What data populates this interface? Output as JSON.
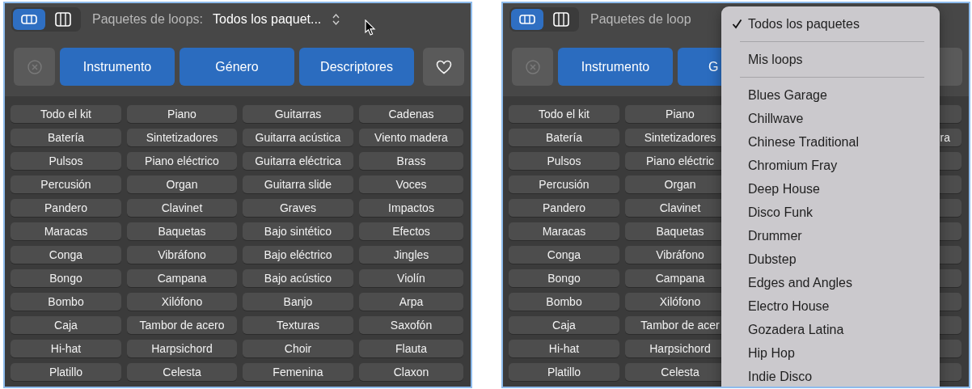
{
  "panels": [
    {
      "view_modes": [
        {
          "kind": "rows",
          "selected": true
        },
        {
          "kind": "columns",
          "selected": false
        }
      ],
      "packs_label": "Paquetes de loops:",
      "packs_value": "Todos los paquet...",
      "filters": [
        {
          "kind": "clear",
          "disabled": true
        },
        {
          "kind": "category",
          "label": "Instrumento"
        },
        {
          "kind": "category",
          "label": "Género"
        },
        {
          "kind": "category",
          "label": "Descriptores"
        },
        {
          "kind": "favorite",
          "show_icon": true
        }
      ],
      "rows": [
        {
          "column_1": "Todo el kit",
          "column_2": "Piano",
          "column_3": "Guitarras",
          "column_4": "Cadenas"
        },
        {
          "column_1": "Batería",
          "column_2": "Sintetizadores",
          "column_3": "Guitarra acústica",
          "column_4": "Viento madera"
        },
        {
          "column_1": "Pulsos",
          "column_2": "Piano eléctrico",
          "column_3": "Guitarra eléctrica",
          "column_4": "Brass"
        },
        {
          "column_1": "Percusión",
          "column_2": "Organ",
          "column_3": "Guitarra slide",
          "column_4": "Voces"
        },
        {
          "column_1": "Pandero",
          "column_2": "Clavinet",
          "column_3": "Graves",
          "column_4": "Impactos"
        },
        {
          "column_1": "Maracas",
          "column_2": "Baquetas",
          "column_3": "Bajo sintético",
          "column_4": "Efectos"
        },
        {
          "column_1": "Conga",
          "column_2": "Vibráfono",
          "column_3": "Bajo eléctrico",
          "column_4": "Jingles"
        },
        {
          "column_1": "Bongo",
          "column_2": "Campana",
          "column_3": "Bajo acústico",
          "column_4": "Violín"
        },
        {
          "column_1": "Bombo",
          "column_2": "Xilófono",
          "column_3": "Banjo",
          "column_4": "Arpa"
        },
        {
          "column_1": "Caja",
          "column_2": "Tambor de acero",
          "column_3": "Texturas",
          "column_4": "Saxofón"
        },
        {
          "column_1": "Hi-hat",
          "column_2": "Harpsichord",
          "column_3": "Choir",
          "column_4": "Flauta"
        },
        {
          "column_1": "Platillo",
          "column_2": "Celesta",
          "column_3": "Femenina",
          "column_4": "Claxon"
        }
      ]
    },
    {
      "view_modes": [
        {
          "kind": "rows",
          "selected": true
        },
        {
          "kind": "columns",
          "selected": false
        }
      ],
      "packs_label": "Paquetes de loop",
      "filters": [
        {
          "kind": "clear",
          "disabled": true
        },
        {
          "kind": "category",
          "label": "Instrumento"
        },
        {
          "kind": "category",
          "label": "G"
        },
        {
          "kind": "favorite",
          "show_icon": false
        }
      ],
      "rows": [
        {
          "column_1": "Todo el kit",
          "column_2": "Piano"
        },
        {
          "column_1": "Batería",
          "column_2": "Sintetizadores",
          "column_4": "ra"
        },
        {
          "column_1": "Pulsos",
          "column_2": "Piano eléctric"
        },
        {
          "column_1": "Percusión",
          "column_2": "Organ"
        },
        {
          "column_1": "Pandero",
          "column_2": "Clavinet"
        },
        {
          "column_1": "Maracas",
          "column_2": "Baquetas"
        },
        {
          "column_1": "Conga",
          "column_2": "Vibráfono"
        },
        {
          "column_1": "Bongo",
          "column_2": "Campana"
        },
        {
          "column_1": "Bombo",
          "column_2": "Xilófono"
        },
        {
          "column_1": "Caja",
          "column_2": "Tambor de acer"
        },
        {
          "column_1": "Hi-hat",
          "column_2": "Harpsichord"
        },
        {
          "column_1": "Platillo",
          "column_2": "Celesta"
        }
      ],
      "menu": [
        {
          "kind": "item",
          "label": "Todos los paquetes",
          "checked": true
        },
        {
          "kind": "separator"
        },
        {
          "kind": "item",
          "label": "Mis loops",
          "checked": false
        },
        {
          "kind": "separator"
        },
        {
          "kind": "item",
          "label": "Blues Garage",
          "checked": false
        },
        {
          "kind": "item",
          "label": "Chillwave",
          "checked": false
        },
        {
          "kind": "item",
          "label": "Chinese Traditional",
          "checked": false
        },
        {
          "kind": "item",
          "label": "Chromium Fray",
          "checked": false
        },
        {
          "kind": "item",
          "label": "Deep House",
          "checked": false
        },
        {
          "kind": "item",
          "label": "Disco Funk",
          "checked": false
        },
        {
          "kind": "item",
          "label": "Drummer",
          "checked": false
        },
        {
          "kind": "item",
          "label": "Dubstep",
          "checked": false
        },
        {
          "kind": "item",
          "label": "Edges and Angles",
          "checked": false
        },
        {
          "kind": "item",
          "label": "Electro House",
          "checked": false
        },
        {
          "kind": "item",
          "label": "Gozadera Latina",
          "checked": false
        },
        {
          "kind": "item",
          "label": "Hip Hop",
          "checked": false
        },
        {
          "kind": "item",
          "label": "Indie Disco",
          "checked": false
        }
      ]
    }
  ]
}
